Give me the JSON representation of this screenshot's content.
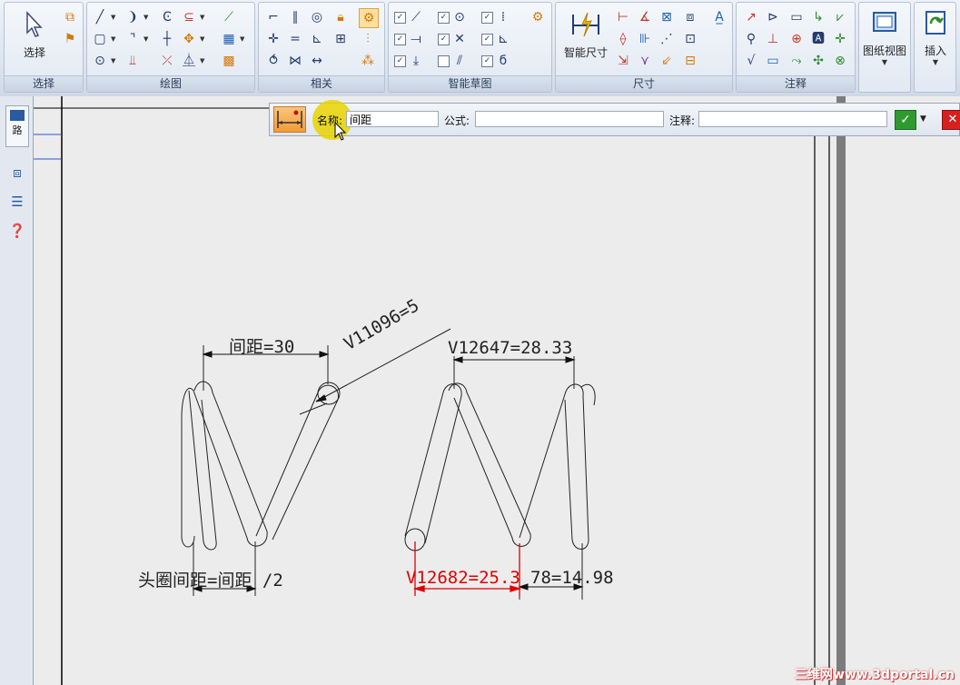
{
  "ribbon": {
    "groups": {
      "select": "选择",
      "draw": "绘图",
      "relate": "相关",
      "smart_sketch": "智能草图",
      "dimension": "尺寸",
      "annotation": "注释"
    },
    "buttons": {
      "select": "选择",
      "smart_dimension": "智能尺寸",
      "drawing_view": "图纸视图",
      "insert": "插入"
    }
  },
  "dock": {
    "vertical_label": "路"
  },
  "command_bar": {
    "name_label": "名称:",
    "name_value": "间距",
    "formula_label": "公式:",
    "formula_value": "",
    "note_label": "注释:",
    "note_value": ""
  },
  "drawing": {
    "dim_left_top": "间距=30",
    "dim_diagonal": "V11096=5",
    "dim_left_bottom": "头圈间距=间距 /2",
    "dim_right_top": "V12647=28.33",
    "dim_right_bottom_red": "V12682=25.3",
    "dim_right_bottom": "78=14.98"
  },
  "watermark": "三维网www.3dportal.cn",
  "colors": {
    "highlight": "#e8d400",
    "red_dim": "#e00000",
    "ok_green": "#2f9b2f",
    "cancel_red": "#d42020"
  }
}
